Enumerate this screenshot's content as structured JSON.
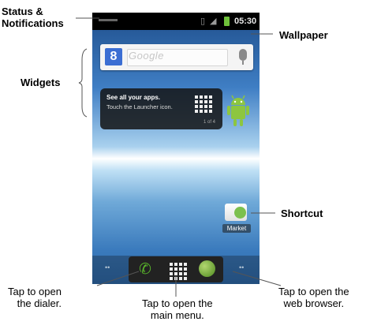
{
  "annotations": {
    "status": "Status &\nNotifications",
    "wallpaper": "Wallpaper",
    "widgets": "Widgets",
    "shortcut": "Shortcut",
    "dialer": "Tap to open\nthe dialer.",
    "main_menu": "Tap to open the\nmain menu.",
    "browser": "Tap to open the\nweb browser."
  },
  "status_bar": {
    "time": "05:30"
  },
  "search_widget": {
    "logo": "8",
    "brand": "Google"
  },
  "tip_widget": {
    "title": "See all your apps.",
    "body": "Touch the Launcher icon.",
    "page": "1 of 4"
  },
  "shortcut_app": {
    "label": "Market"
  },
  "icons": {
    "signal": "signal-icon",
    "battery": "battery-icon",
    "dialer": "phone-icon",
    "menu": "app-grid-icon",
    "browser": "globe-icon",
    "mic": "mic-icon"
  },
  "colors": {
    "battery": "#6ec03a",
    "dialer": "#59b52b",
    "google_blue": "#3b6ed3"
  }
}
